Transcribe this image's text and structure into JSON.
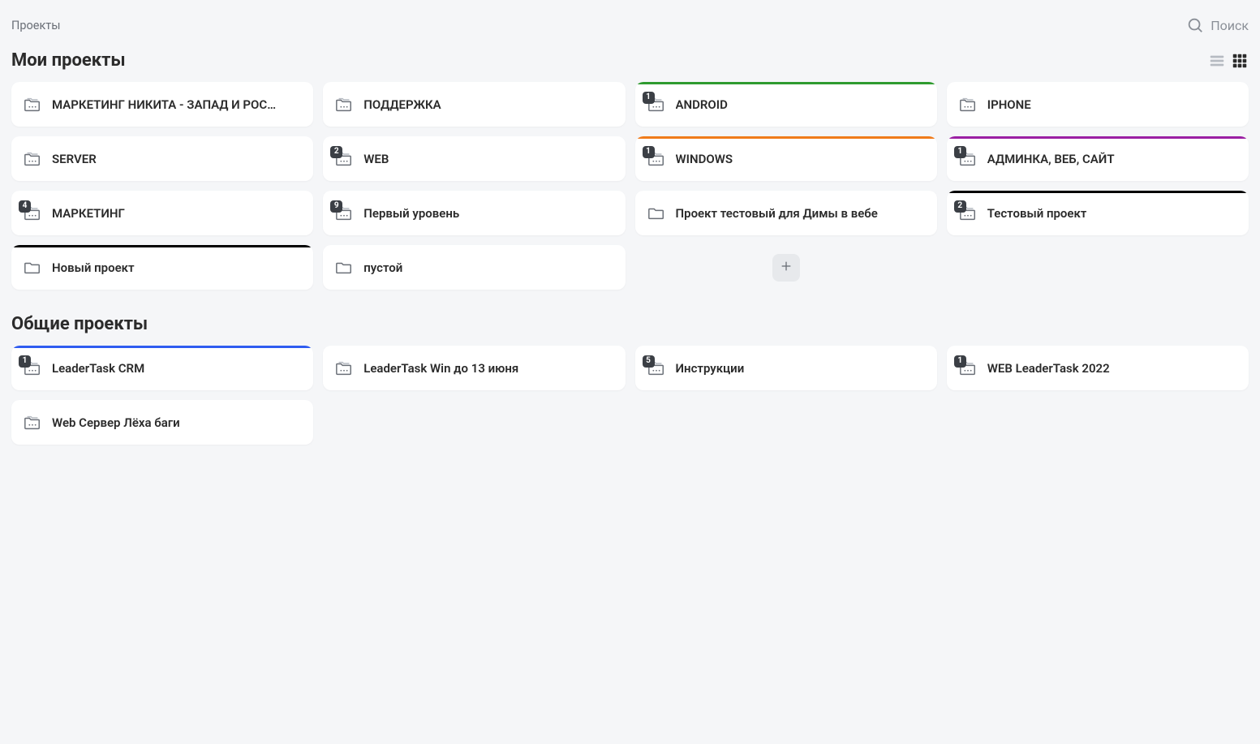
{
  "header": {
    "breadcrumb": "Проекты",
    "search_label": "Поиск"
  },
  "sections": {
    "my": {
      "title": "Мои проекты",
      "projects": [
        {
          "title": "МАРКЕТИНГ НИКИТА - ЗАПАД И РОС…",
          "icon": "multi",
          "badge": "",
          "accent": ""
        },
        {
          "title": "ПОДДЕРЖКА",
          "icon": "multi",
          "badge": "",
          "accent": ""
        },
        {
          "title": "ANDROID",
          "icon": "multi",
          "badge": "1",
          "accent": "#2f9b2f"
        },
        {
          "title": "IPHONE",
          "icon": "multi",
          "badge": "",
          "accent": ""
        },
        {
          "title": "SERVER",
          "icon": "multi",
          "badge": "",
          "accent": ""
        },
        {
          "title": "WEB",
          "icon": "multi",
          "badge": "2",
          "accent": ""
        },
        {
          "title": "WINDOWS",
          "icon": "multi",
          "badge": "1",
          "accent": "#f07b1a"
        },
        {
          "title": "АДМИНКА, ВЕБ, САЙТ",
          "icon": "multi",
          "badge": "1",
          "accent": "#9b1fa3"
        },
        {
          "title": "МАРКЕТИНГ",
          "icon": "multi",
          "badge": "4",
          "accent": ""
        },
        {
          "title": "Первый уровень",
          "icon": "multi",
          "badge": "9",
          "accent": ""
        },
        {
          "title": "Проект тестовый для Димы в вебе",
          "icon": "single",
          "badge": "",
          "accent": ""
        },
        {
          "title": "Тестовый проект",
          "icon": "multi",
          "badge": "2",
          "accent": "#000000"
        },
        {
          "title": "Новый проект",
          "icon": "single",
          "badge": "",
          "accent": "#000000"
        },
        {
          "title": "пустой",
          "icon": "single",
          "badge": "",
          "accent": ""
        }
      ]
    },
    "shared": {
      "title": "Общие проекты",
      "projects": [
        {
          "title": "LeaderTask CRM",
          "icon": "multi",
          "badge": "1",
          "accent": "#2f5cf0"
        },
        {
          "title": "LeaderTask Win до 13 июня",
          "icon": "multi",
          "badge": "",
          "accent": ""
        },
        {
          "title": "Инструкции",
          "icon": "multi",
          "badge": "5",
          "accent": ""
        },
        {
          "title": "WEB LeaderTask 2022",
          "icon": "multi",
          "badge": "1",
          "accent": ""
        },
        {
          "title": "Web Сервер Лёха баги",
          "icon": "multi",
          "badge": "",
          "accent": ""
        }
      ]
    }
  }
}
